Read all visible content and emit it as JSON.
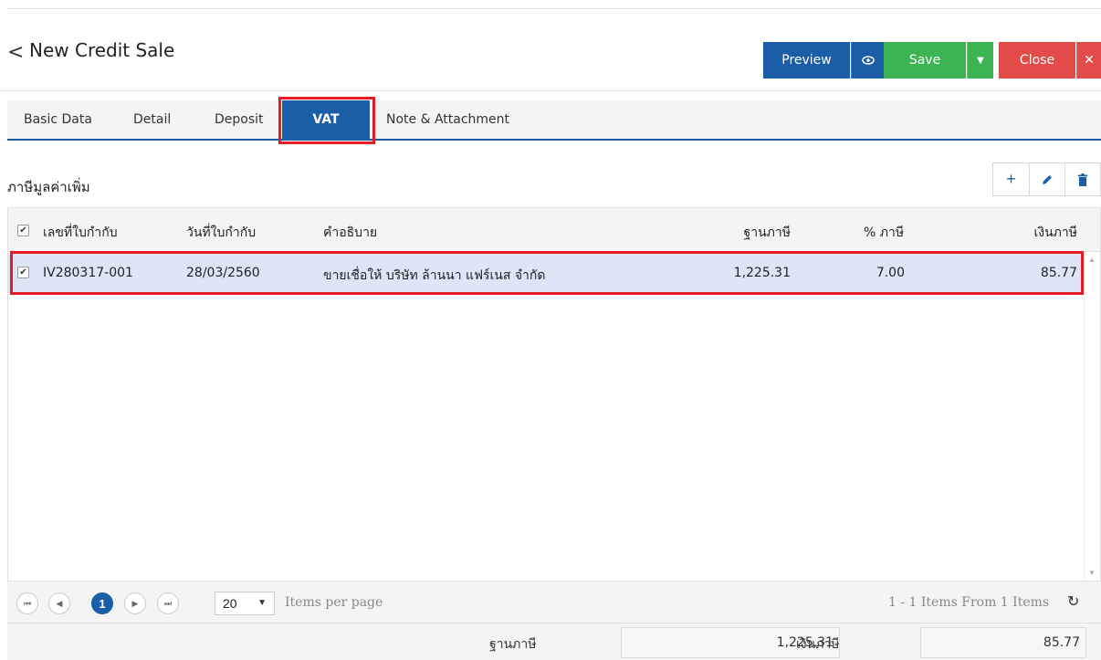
{
  "header": {
    "back_glyph": "<",
    "title": "New Credit Sale",
    "preview_label": "Preview",
    "preview_icon": "eye-icon",
    "save_label": "Save",
    "save_dropdown_icon": "caret-down-icon",
    "close_label": "Close",
    "close_icon": "close-icon"
  },
  "tabs": [
    {
      "label": "Basic Data",
      "active": false
    },
    {
      "label": "Detail",
      "active": false
    },
    {
      "label": "Deposit",
      "active": false
    },
    {
      "label": "VAT",
      "active": true
    },
    {
      "label": "Note & Attachment",
      "active": false
    }
  ],
  "section": {
    "title": "ภาษีมูลค่าเพิ่ม",
    "tools": [
      "plus-icon",
      "pencil-icon",
      "trash-icon"
    ]
  },
  "table": {
    "columns": [
      "เลขที่ใบกำกับ",
      "วันที่ใบกำกับ",
      "คำอธิบาย",
      "ฐานภาษี",
      "% ภาษี",
      "เงินภาษี"
    ],
    "rows": [
      {
        "checked": true,
        "invoice_no": "IV280317-001",
        "invoice_date": "28/03/2560",
        "description": "ขายเชื่อให้ บริษัท ล้านนา แฟร์เนส จำกัด",
        "tax_base": "1,225.31",
        "tax_percent": "7.00",
        "tax_amount": "85.77"
      }
    ]
  },
  "pager": {
    "current_page": "1",
    "page_size": "20",
    "items_per_page_label": "Items per page",
    "summary": "1 - 1 Items From 1 Items"
  },
  "summary": {
    "tax_base_label": "ฐานภาษี",
    "tax_base_value": "1,225.31",
    "tax_amount_label": "เงินภาษี",
    "tax_amount_value": "85.77"
  },
  "colors": {
    "primary": "#1a5ea8",
    "save": "#3cb451",
    "close": "#e24b47",
    "highlight": "#e51c23",
    "selected_row": "#dce6f7"
  }
}
